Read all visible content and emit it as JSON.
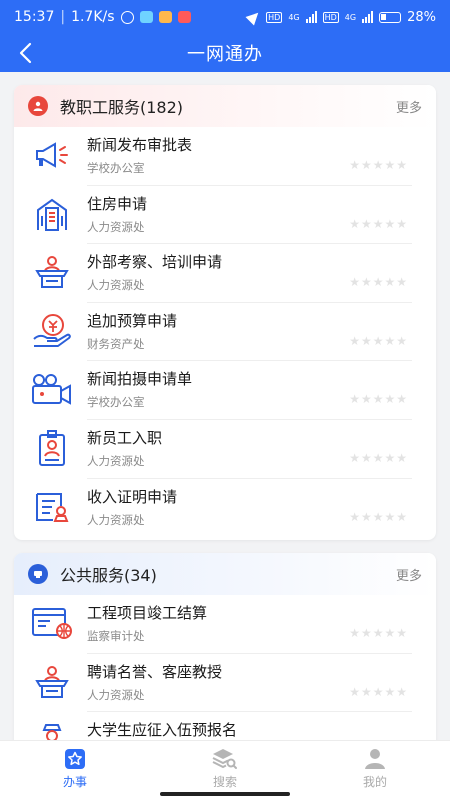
{
  "status": {
    "time": "15:37",
    "speed": "1.7K/s",
    "net1": "HD",
    "gen1": "4G",
    "net2": "HD",
    "gen2": "4G",
    "battery": "28%"
  },
  "header": {
    "title": "一网通办"
  },
  "sections": [
    {
      "title": "教职工服务(182)",
      "more": "更多",
      "items": [
        {
          "title": "新闻发布审批表",
          "dept": "学校办公室",
          "icon": "megaphone-icon"
        },
        {
          "title": "住房申请",
          "dept": "人力资源处",
          "icon": "building-icon"
        },
        {
          "title": "外部考察、培训申请",
          "dept": "人力资源处",
          "icon": "lectern-icon"
        },
        {
          "title": "追加预算申请",
          "dept": "财务资产处",
          "icon": "money-hand-icon"
        },
        {
          "title": "新闻拍摄申请单",
          "dept": "学校办公室",
          "icon": "camera-icon"
        },
        {
          "title": "新员工入职",
          "dept": "人力资源处",
          "icon": "id-badge-icon"
        },
        {
          "title": "收入证明申请",
          "dept": "人力资源处",
          "icon": "certificate-icon"
        }
      ]
    },
    {
      "title": "公共服务(34)",
      "more": "更多",
      "items": [
        {
          "title": "工程项目竣工结算",
          "dept": "监察审计处",
          "icon": "web-project-icon"
        },
        {
          "title": "聘请名誉、客座教授",
          "dept": "人力资源处",
          "icon": "lectern-icon"
        },
        {
          "title": "大学生应征入伍预报名",
          "dept": "",
          "icon": "soldier-icon"
        }
      ]
    }
  ],
  "stars": "★★★★★",
  "tabs": [
    {
      "label": "办事",
      "icon": "office-icon",
      "active": true
    },
    {
      "label": "搜索",
      "icon": "search-stack-icon",
      "active": false
    },
    {
      "label": "我的",
      "icon": "person-icon",
      "active": false
    }
  ],
  "colors": {
    "primary": "#2d6df6",
    "icon_red": "#e8473c",
    "icon_blue": "#2b5fd9"
  }
}
